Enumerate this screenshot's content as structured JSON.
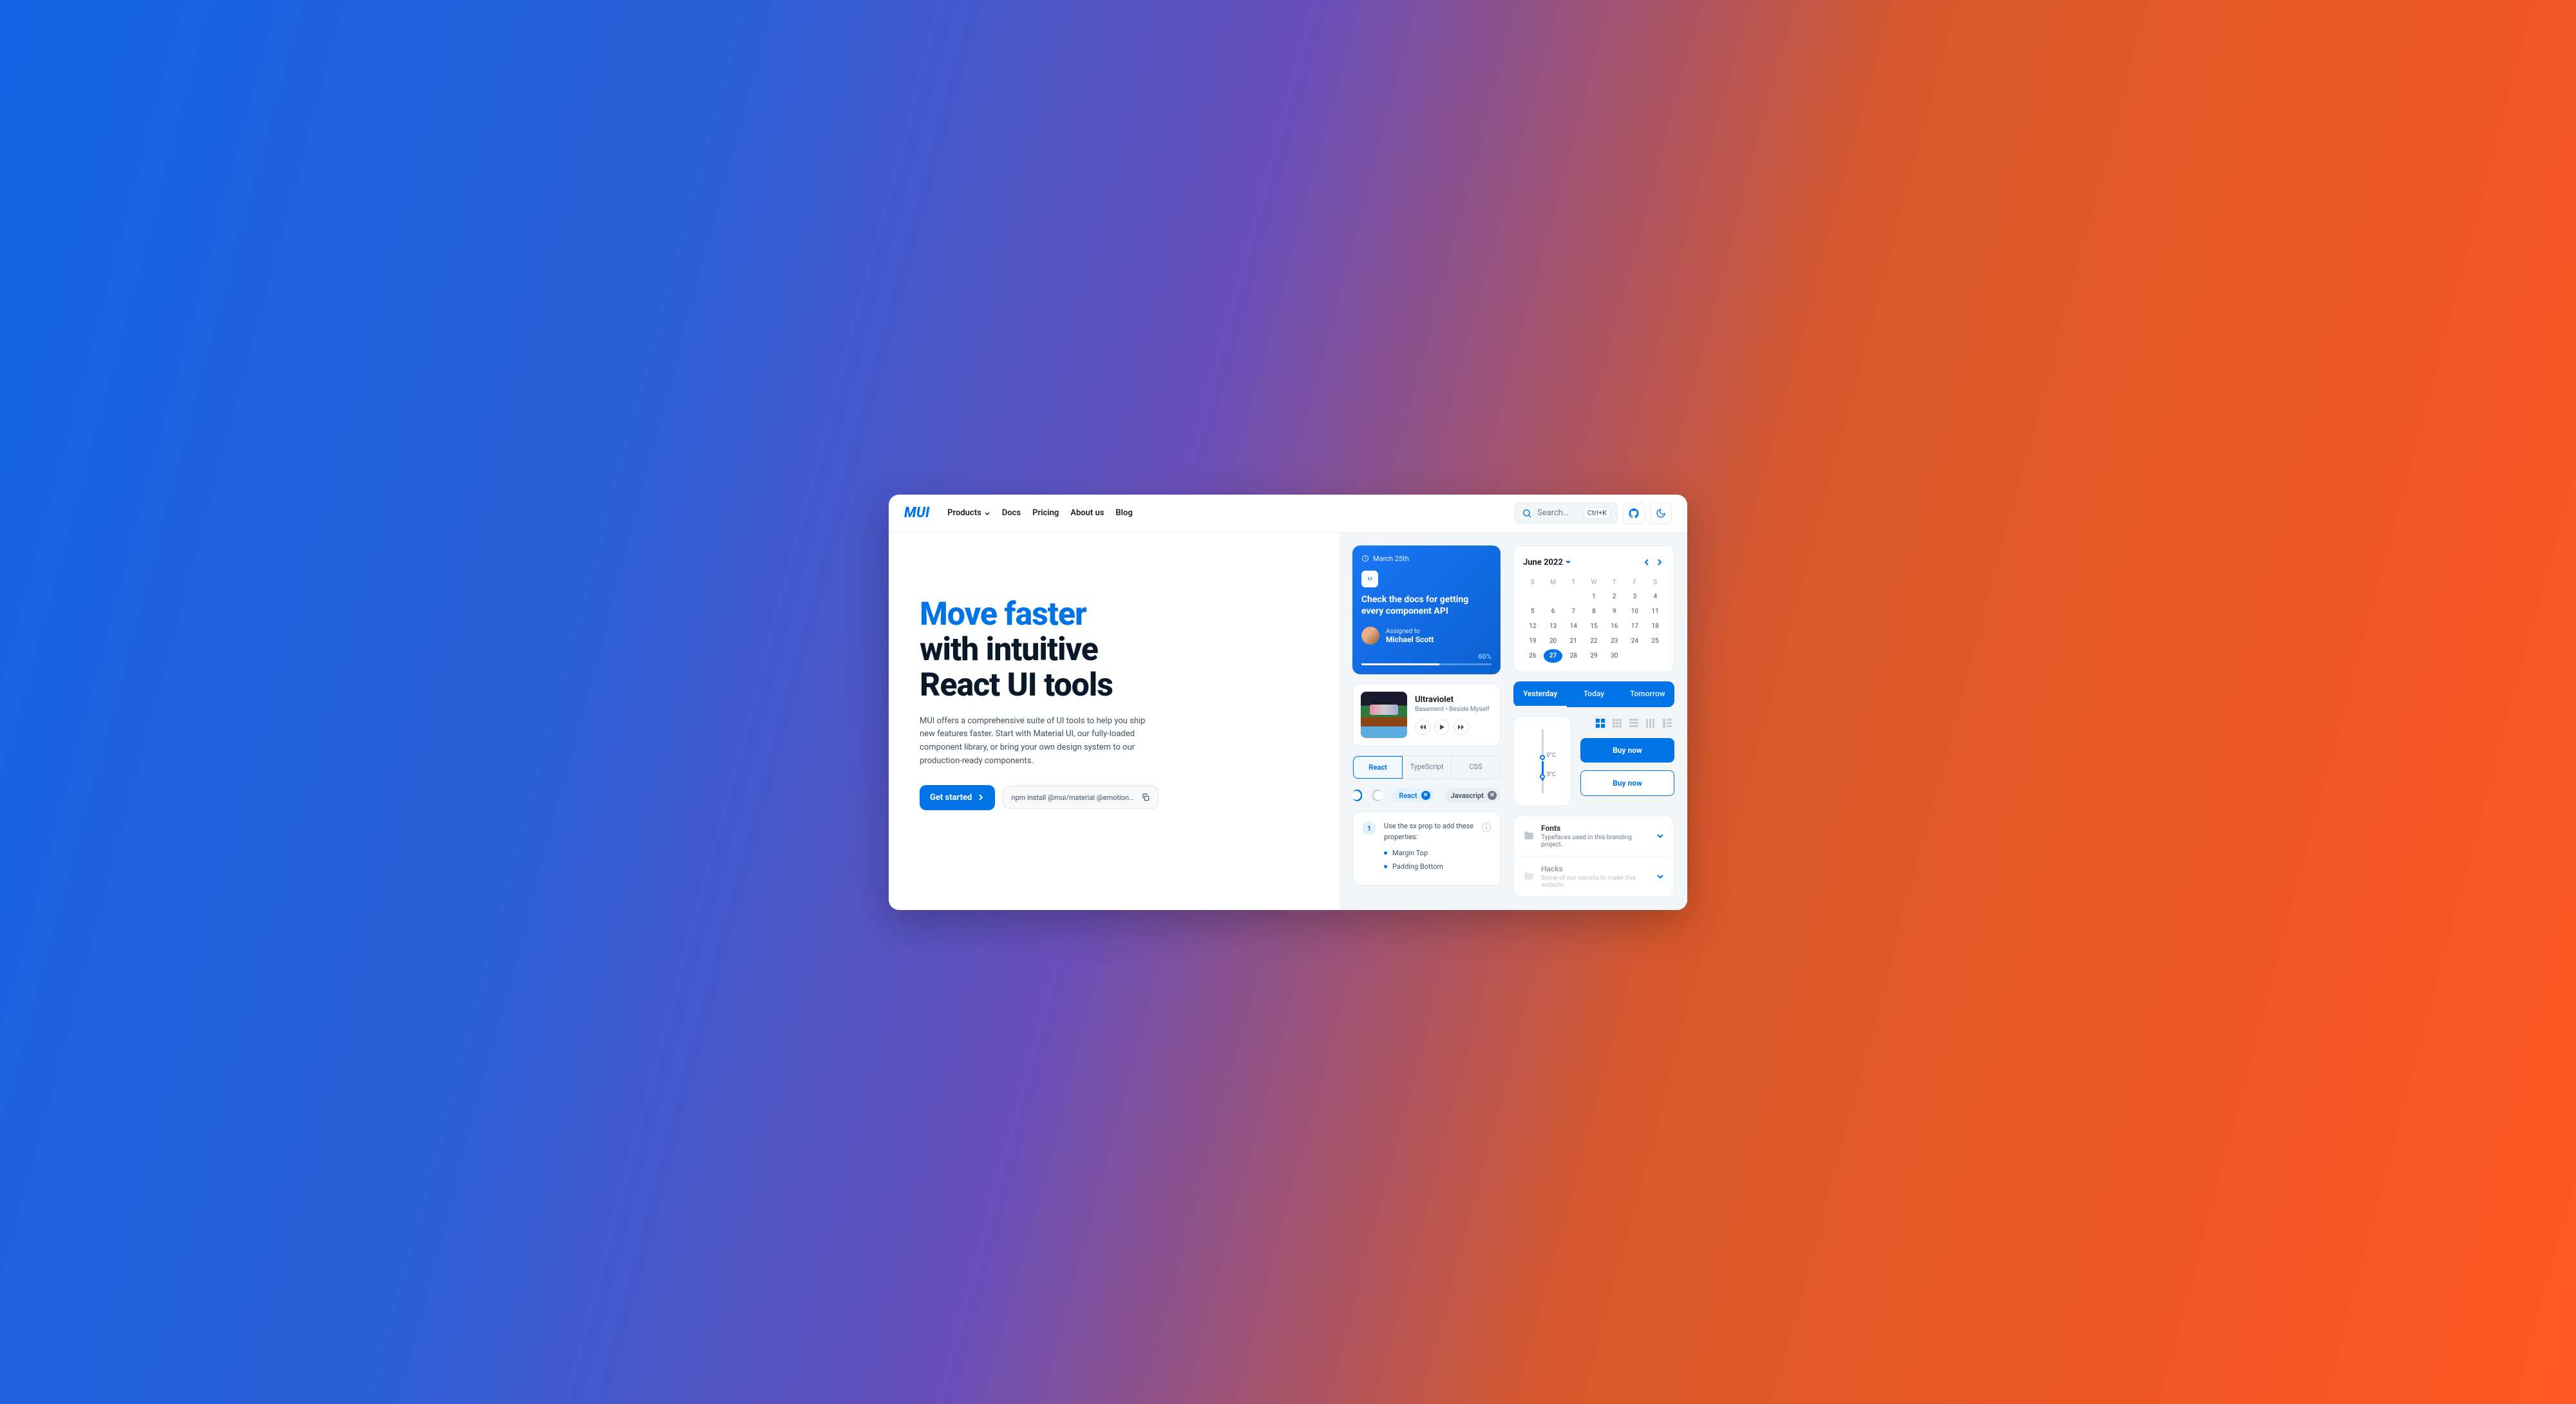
{
  "logo": "MUI",
  "nav": {
    "products": "Products",
    "docs": "Docs",
    "pricing": "Pricing",
    "about": "About us",
    "blog": "Blog"
  },
  "search": {
    "placeholder": "Search…",
    "kbd": "Ctrl+K"
  },
  "hero": {
    "title_accent": "Move faster",
    "title_line2": "with intuitive",
    "title_line3": "React UI tools",
    "subtitle": "MUI offers a comprehensive suite of UI tools to help you ship new features faster. Start with Material UI, our fully-loaded component library, or bring your own design system to our production-ready components.",
    "cta": "Get started",
    "install": "npm install @mui/material @emotion…"
  },
  "task": {
    "date": "March 25th",
    "title": "Check the docs for getting every component API",
    "assigned_label": "Assigned to",
    "assignee": "Michael Scott",
    "progress": "60%"
  },
  "calendar": {
    "month": "June 2022",
    "dow": [
      "S",
      "M",
      "T",
      "W",
      "T",
      "F",
      "S"
    ],
    "weeks": [
      [
        "",
        "",
        "",
        "1",
        "2",
        "3",
        "4"
      ],
      [
        "5",
        "6",
        "7",
        "8",
        "9",
        "10",
        "11"
      ],
      [
        "12",
        "13",
        "14",
        "15",
        "16",
        "17",
        "18"
      ],
      [
        "19",
        "20",
        "21",
        "22",
        "23",
        "24",
        "25"
      ],
      [
        "26",
        "27",
        "28",
        "29",
        "30",
        "",
        ""
      ]
    ],
    "selected": "27"
  },
  "music": {
    "title": "Ultraviolet",
    "artist": "Basement • Beside Myself"
  },
  "pilltabs": {
    "yesterday": "Yesterday",
    "today": "Today",
    "tomorrow": "Tomorrow"
  },
  "segtabs": {
    "react": "React",
    "typescript": "TypeScript",
    "css": "CSS"
  },
  "chips": {
    "react": "React",
    "javascript": "Javascript"
  },
  "slider": {
    "top": "0°C",
    "bottom": "5°C"
  },
  "buy": {
    "fill": "Buy now",
    "outline": "Buy now"
  },
  "step": {
    "num": "1",
    "text": "Use the sx prop to add these properties:",
    "items": [
      "Margin Top",
      "Padding Bottom"
    ]
  },
  "accordion": {
    "fonts_title": "Fonts",
    "fonts_sub": "Typefaces used in this branding project.",
    "hacks_title": "Hacks",
    "hacks_sub": "Some of our secrets to make this website."
  }
}
